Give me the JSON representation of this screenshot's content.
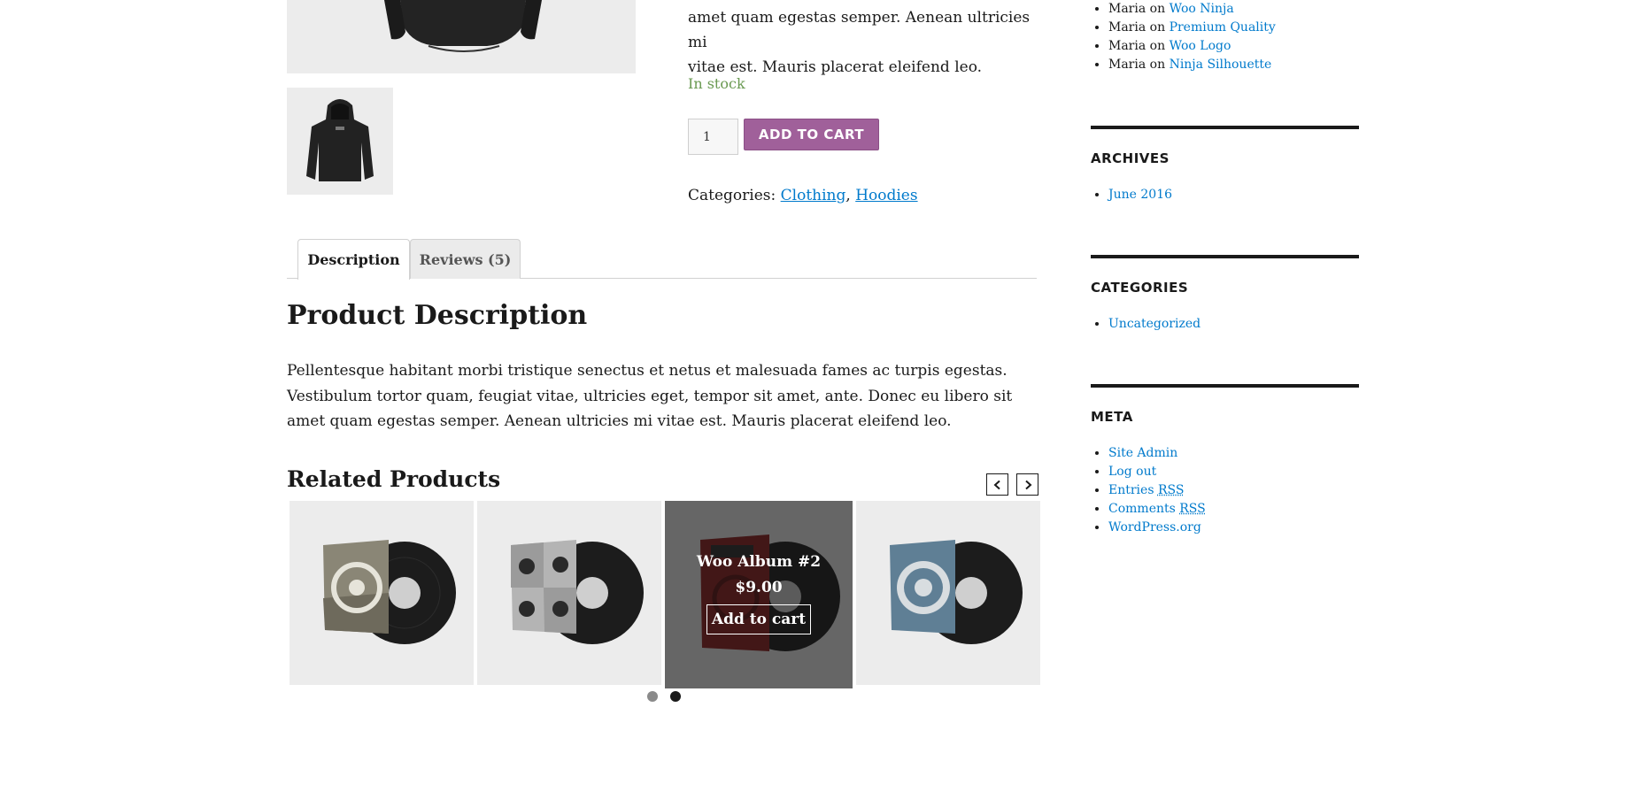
{
  "product": {
    "summary_lines": [
      "amet quam egestas semper. Aenean ultricies mi",
      "vitae est. Mauris placerat eleifend leo."
    ],
    "stock": "In stock",
    "quantity": "1",
    "add_to_cart_label": "ADD TO CART",
    "categories_label": "Categories:",
    "categories": [
      "Clothing",
      "Hoodies"
    ],
    "category_separator": ", "
  },
  "tabs": [
    {
      "label": "Description",
      "active": true
    },
    {
      "label": "Reviews (5)",
      "active": false
    }
  ],
  "description": {
    "heading": "Product Description",
    "body": "Pellentesque habitant morbi tristique senectus et netus et malesuada fames ac turpis egestas. Vestibulum tortor quam, feugiat vitae, ultricies eget, tempor sit amet, ante. Donec eu libero sit amet quam egestas semper. Aenean ultricies mi vitae est. Mauris placerat eleifend leo."
  },
  "related": {
    "heading": "Related Products",
    "hovered_product": {
      "name": "Woo Album #2",
      "price": "$9.00",
      "add_label": "Add to cart"
    },
    "pagination": {
      "pages": 2,
      "active_page": 2
    }
  },
  "sidebar": {
    "recent_comments": [
      {
        "author": "Maria",
        "on": "on",
        "post": "Woo Ninja"
      },
      {
        "author": "Maria",
        "on": "on",
        "post": "Premium Quality"
      },
      {
        "author": "Maria",
        "on": "on",
        "post": "Woo Logo"
      },
      {
        "author": "Maria",
        "on": "on",
        "post": "Ninja Silhouette"
      }
    ],
    "archives": {
      "title": "ARCHIVES",
      "items": [
        "June 2016"
      ]
    },
    "categories": {
      "title": "CATEGORIES",
      "items": [
        "Uncategorized"
      ]
    },
    "meta": {
      "title": "META",
      "items": [
        {
          "text": "Site Admin",
          "abbr": ""
        },
        {
          "text": "Log out",
          "abbr": ""
        },
        {
          "text": "Entries ",
          "abbr": "RSS"
        },
        {
          "text": "Comments ",
          "abbr": "RSS"
        },
        {
          "text": "WordPress.org",
          "abbr": ""
        }
      ]
    }
  },
  "colors": {
    "accent": "#a0609a",
    "link": "#007acc",
    "in_stock": "#6a9a52",
    "text": "#1a1a1a"
  },
  "icons": {
    "prev": "chevron-left-icon",
    "next": "chevron-right-icon"
  }
}
